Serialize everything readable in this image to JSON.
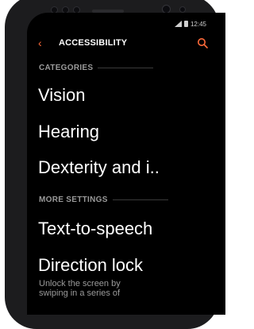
{
  "status": {
    "time": "12:45"
  },
  "header": {
    "title": "ACCESSIBILITY"
  },
  "sections": [
    {
      "label": "CATEGORIES"
    },
    {
      "label": "MORE SETTINGS"
    }
  ],
  "categories": [
    {
      "label": "Vision"
    },
    {
      "label": "Hearing"
    },
    {
      "label": "Dexterity and i.."
    }
  ],
  "more_settings": [
    {
      "label": "Text-to-speech"
    },
    {
      "label": "Direction lock",
      "description_line1": "Unlock the screen by",
      "description_line2": "swiping in a series of"
    }
  ],
  "colors": {
    "accent": "#ff6a3a",
    "background": "#000000",
    "section_text": "#9a9a9a"
  }
}
